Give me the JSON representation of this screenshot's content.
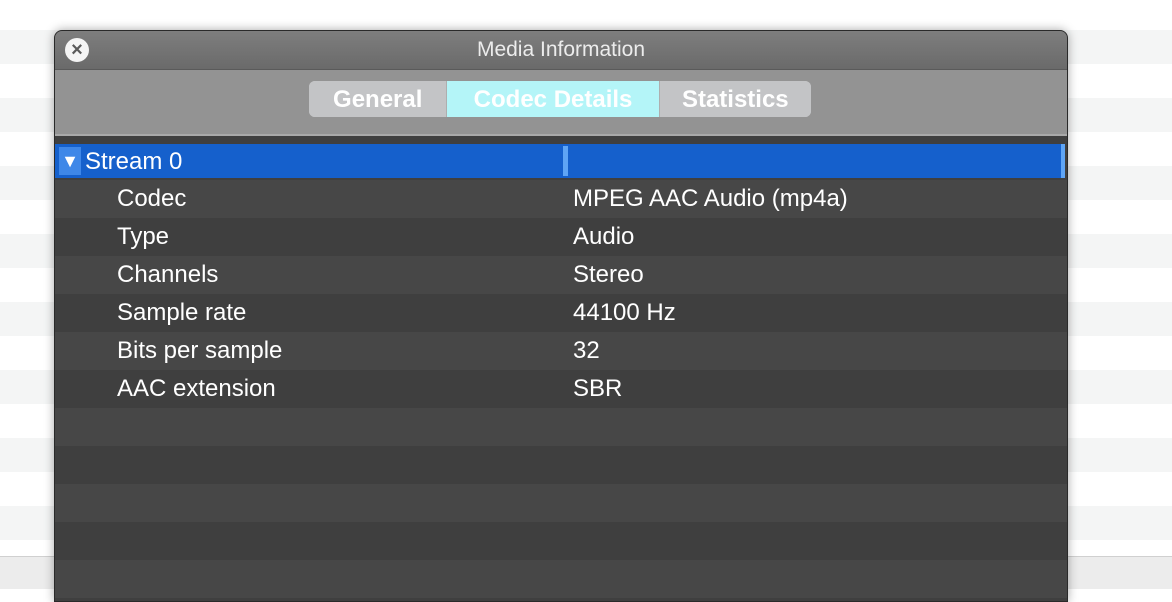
{
  "window": {
    "title": "Media Information"
  },
  "tabs": [
    {
      "label": "General",
      "selected": false
    },
    {
      "label": "Codec Details",
      "selected": true
    },
    {
      "label": "Statistics",
      "selected": false
    }
  ],
  "stream": {
    "label": "Stream 0",
    "expanded": true,
    "properties": [
      {
        "key": "Codec",
        "value": "MPEG AAC Audio (mp4a)"
      },
      {
        "key": "Type",
        "value": "Audio"
      },
      {
        "key": "Channels",
        "value": "Stereo"
      },
      {
        "key": "Sample rate",
        "value": "44100 Hz"
      },
      {
        "key": "Bits per sample",
        "value": "32"
      },
      {
        "key": "AAC extension",
        "value": "SBR"
      }
    ]
  },
  "colors": {
    "selection": "#1560cc",
    "selected_tab": "#b4f5f8",
    "panel_bg": "#3f3f3f"
  },
  "icons": {
    "close": "close-icon",
    "disclosure": "disclosure-triangle-down-icon"
  }
}
